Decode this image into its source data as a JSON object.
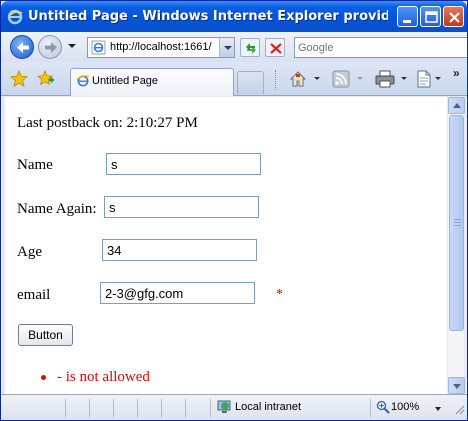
{
  "window": {
    "title": "Untitled Page - Windows Internet Explorer provided by ...",
    "min_icon": "minimize-icon",
    "max_icon": "maximize-icon",
    "close_icon": "close-icon"
  },
  "address_bar": {
    "url": "http://localhost:1661/",
    "search_placeholder": "Google"
  },
  "tabs": [
    {
      "label": "Untitled Page",
      "icon": "ie-page-icon"
    }
  ],
  "toolbar": {
    "icons": [
      "home-icon",
      "rss-feeds-icon",
      "print-icon",
      "page-icon"
    ]
  },
  "page": {
    "postback_text": "Last postback on: 2:10:27 PM",
    "fields": [
      {
        "label": "Name",
        "value": "s"
      },
      {
        "label": "Name Again:",
        "value": "s"
      },
      {
        "label": "Age",
        "value": "34"
      },
      {
        "label": "email",
        "value": "2-3@gfg.com",
        "validator": "*"
      }
    ],
    "button_label": "Button",
    "errors": [
      "- is not allowed"
    ]
  },
  "status": {
    "zone": "Local intranet",
    "zoom": "100%"
  },
  "colors": {
    "titlebar": "#0454d9",
    "error": "#ee0000",
    "input_border": "#7f9db9"
  }
}
